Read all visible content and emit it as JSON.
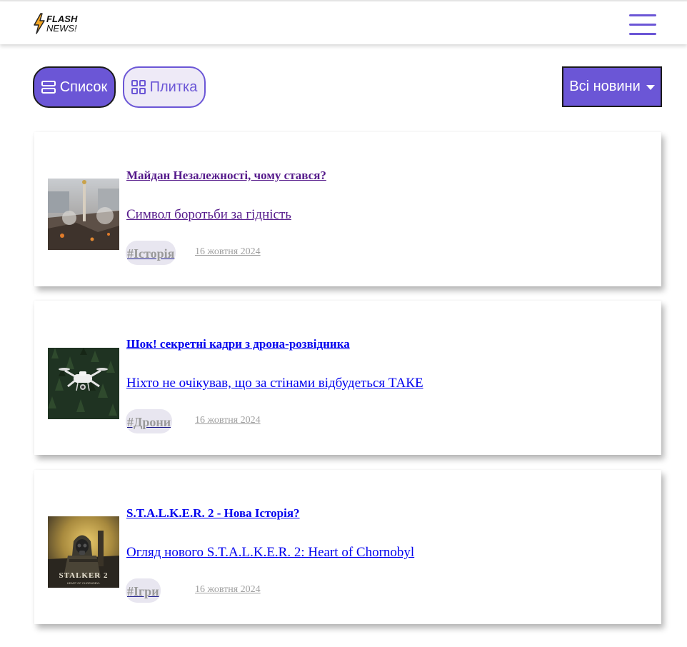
{
  "brand": {
    "line1": "FLASH",
    "line2": "NEWS!",
    "accent": "#6b56d6",
    "bolt_color": "#f5a623"
  },
  "header": {
    "menu_icon": "hamburger-icon"
  },
  "view_toggle": {
    "list_label": "Список",
    "list_icon": "list-icon",
    "tile_label": "Плитка",
    "tile_icon": "grid-icon"
  },
  "filter": {
    "selected": "Всі новини",
    "icon": "caret-down-icon"
  },
  "articles": [
    {
      "title": "Майдан Незалежності, чому стався?",
      "subtitle": "Символ боротьби за гідність",
      "tag": "#Історія",
      "date": "16 жовтня 2024",
      "image": "maidan-photo"
    },
    {
      "title": "Шок! секретні кадри з дрона-розвідника",
      "subtitle": "Ніхто не очікував, що за стінами відбудеться ТАКЕ",
      "tag": "#Дрони",
      "date": "16 жовтня 2024",
      "image": "drone-photo"
    },
    {
      "title": "S.T.A.L.K.E.R. 2 - Нова Історія?",
      "subtitle": "Огляд нового S.T.A.L.K.E.R. 2: Heart of Chornobyl",
      "tag": "#Ігри",
      "date": "16 жовтня 2024",
      "image": "stalker-cover"
    }
  ],
  "stalker_cover_text": {
    "logo": "STALKER 2",
    "tagline": "HEART OF CHORNOBYL"
  }
}
